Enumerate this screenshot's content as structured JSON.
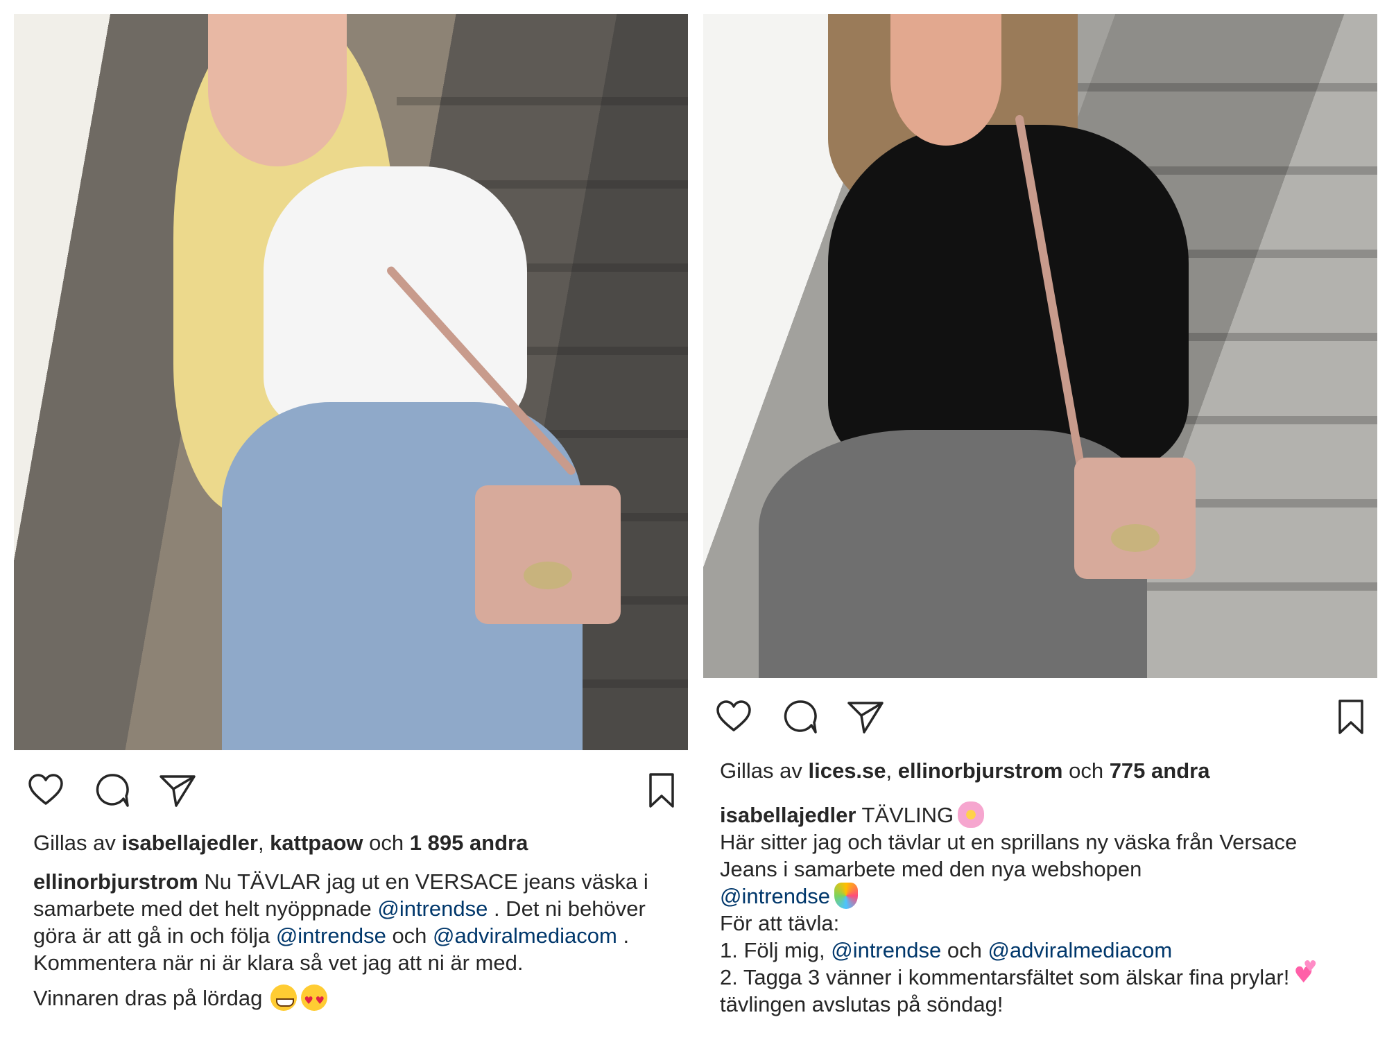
{
  "posts": [
    {
      "actions": {
        "like_icon": "heart-outline-icon",
        "comment_icon": "comment-bubble-icon",
        "share_icon": "paper-plane-icon",
        "save_icon": "bookmark-icon"
      },
      "likes": {
        "prefix": "Gillas av ",
        "user1": "isabellajedler",
        "sep": ", ",
        "user2": "kattpaow",
        "and": " och ",
        "count": "1 895 andra"
      },
      "caption": {
        "username": "ellinorbjurstrom",
        "text1": " Nu TÄVLAR jag ut en VERSACE jeans väska i samarbete med det helt nyöppnade ",
        "mention1": "@intrendse",
        "text2": " . Det ni behöver göra är att gå in och följa ",
        "mention2": "@intrendse",
        "text3": " och ",
        "mention3": "@adviralmediacom",
        "text4": " . Kommentera när ni är klara så vet jag att ni är med.",
        "final": "Vinnaren dras på lördag",
        "emojis": [
          "grinning-face-emoji",
          "heart-eyes-emoji"
        ]
      }
    },
    {
      "actions": {
        "like_icon": "heart-outline-icon",
        "comment_icon": "comment-bubble-icon",
        "share_icon": "paper-plane-icon",
        "save_icon": "bookmark-icon"
      },
      "likes": {
        "prefix": "Gillas av ",
        "user1": "lices.se",
        "sep": ", ",
        "user2": "ellinorbjurstrom",
        "and": " och ",
        "count": "775 andra"
      },
      "caption": {
        "username": "isabellajedler",
        "title": " TÄVLING",
        "line1": "Här sitter jag och tävlar ut en sprillans ny väska från Versace Jeans i samarbete med den nya webshopen",
        "mention1": "@intrendse",
        "line3": "För att tävla:",
        "step1_prefix": "1. Följ mig, ",
        "step1_mention1": "@intrendse",
        "step1_and": " och ",
        "step1_mention2": "@adviralmediacom",
        "step2a": "2. Tagga 3 vänner i kommentarsfältet som älskar fina prylar!",
        "step2b": " tävlingen avslutas på söndag!",
        "emojis": [
          "cherry-blossom-emoji",
          "party-popper-emoji",
          "two-hearts-emoji"
        ]
      }
    }
  ]
}
